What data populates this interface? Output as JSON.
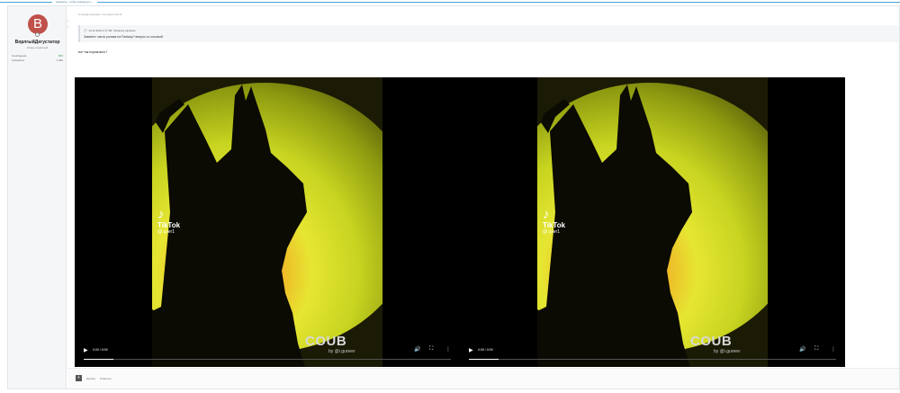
{
  "top_bar": {
    "label": "Нажмите, чтобы развернуть..."
  },
  "author": {
    "avatar_letter": "B",
    "name": "ВорлгыйДегустатор",
    "title": "Очень приятный",
    "stats": [
      {
        "label": "Сообщения",
        "value": "854"
      },
      {
        "label": "Симпатии",
        "value": "1 266"
      }
    ]
  },
  "post": {
    "meta": "Отредактировано: Сегодня в 09:11",
    "quote": {
      "author_line": "13.11.2021 в 17:08, Vulcanus написал:",
      "text": "Заменит части ролика на Fantasy? вопрос со ссылкой"
    },
    "text": "вот так нормально?"
  },
  "videos": [
    {
      "tiktok": "TikTok",
      "handle": "@ user1",
      "coub": "COUB",
      "coub_by": "by @i.gureev",
      "time": "0:00 / 0:09",
      "progress": 0.08
    },
    {
      "tiktok": "TikTok",
      "handle": "@ user1",
      "coub": "COUB",
      "coub_by": "by @i.gureev",
      "time": "0:00 / 0:09",
      "progress": 0.08
    }
  ],
  "footer": {
    "quote_label": "Цитата",
    "reply_label": "Ответить"
  },
  "colors": {
    "accent": "#4aa3d4",
    "avatar": "#c0504a"
  }
}
